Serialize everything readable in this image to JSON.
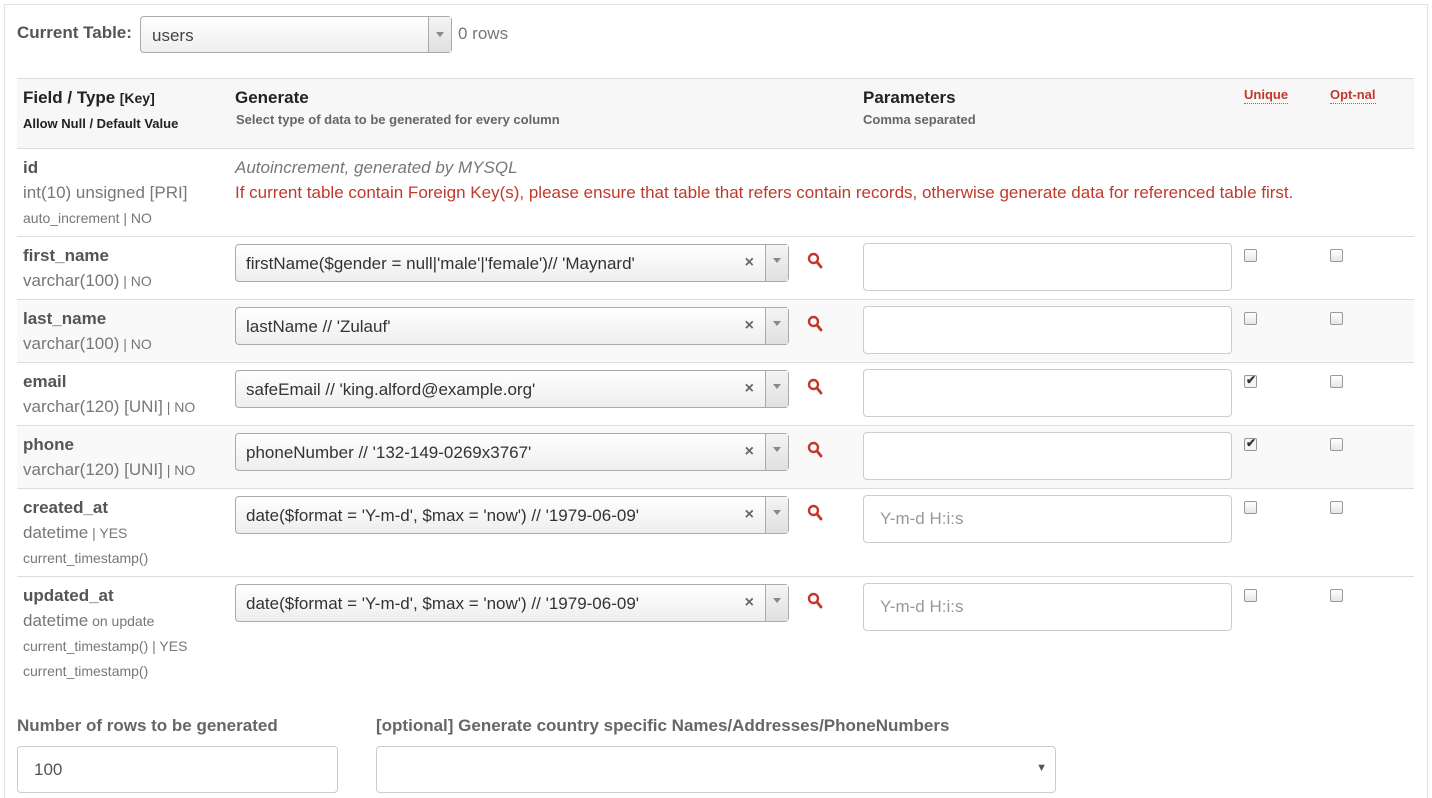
{
  "current_table": {
    "label": "Current Table:",
    "selected": "users",
    "row_count": "0 rows"
  },
  "header": {
    "field_type": "Field / Type",
    "key": "[Key]",
    "allow_null_default": "Allow Null / Default Value",
    "generate": "Generate",
    "generate_sub": "Select type of data to be generated for every column",
    "parameters": "Parameters",
    "parameters_sub": "Comma separated",
    "unique": "Unique",
    "optional": "Opt-nal"
  },
  "id_row": {
    "name": "id",
    "type": "int(10) unsigned [PRI]",
    "extra": "auto_increment | NO",
    "auto_note": "Autoincrement, generated by MYSQL",
    "fk_warning": "If current table contain Foreign Key(s), please ensure that table that refers contain records, otherwise generate data for referenced table first."
  },
  "fields": [
    {
      "name": "first_name",
      "type": "varchar(100)",
      "suffix": " | NO",
      "generator": "firstName($gender = null|'male'|'female')// 'Maynard'",
      "param": "",
      "param_placeholder": "",
      "unique": false,
      "optional": false
    },
    {
      "name": "last_name",
      "type": "varchar(100)",
      "suffix": " | NO",
      "generator": "lastName // 'Zulauf'",
      "param": "",
      "param_placeholder": "",
      "unique": false,
      "optional": false
    },
    {
      "name": "email",
      "type": "varchar(120) [UNI]",
      "suffix": " | NO",
      "generator": "safeEmail // 'king.alford@example.org'",
      "param": "",
      "param_placeholder": "",
      "unique": true,
      "optional": false
    },
    {
      "name": "phone",
      "type": "varchar(120) [UNI]",
      "suffix": " | NO",
      "generator": "phoneNumber // '132-149-0269x3767'",
      "param": "",
      "param_placeholder": "",
      "unique": true,
      "optional": false
    },
    {
      "name": "created_at",
      "type": "datetime",
      "suffix": " | YES",
      "extra_lines": [
        "current_timestamp()"
      ],
      "generator": "date($format = 'Y-m-d', $max = 'now') // '1979-06-09'",
      "param": "",
      "param_placeholder": "Y-m-d H:i:s",
      "unique": false,
      "optional": false
    },
    {
      "name": "updated_at",
      "type": "datetime",
      "suffix": " on update",
      "extra_lines": [
        "current_timestamp() | YES",
        "current_timestamp()"
      ],
      "generator": "date($format = 'Y-m-d', $max = 'now') // '1979-06-09'",
      "param": "",
      "param_placeholder": "Y-m-d H:i:s",
      "unique": false,
      "optional": false
    }
  ],
  "footer": {
    "rows_label": "Number of rows to be generated",
    "rows_value": "100",
    "country_label": "[optional] Generate country specific Names/Addresses/PhoneNumbers",
    "country_value": ""
  },
  "icons": {
    "search": "search-icon",
    "clear": "clear-icon",
    "dropdown": "chevron-down-icon"
  },
  "colors": {
    "warning_red": "#c0392b",
    "search_red": "#c0392b"
  }
}
